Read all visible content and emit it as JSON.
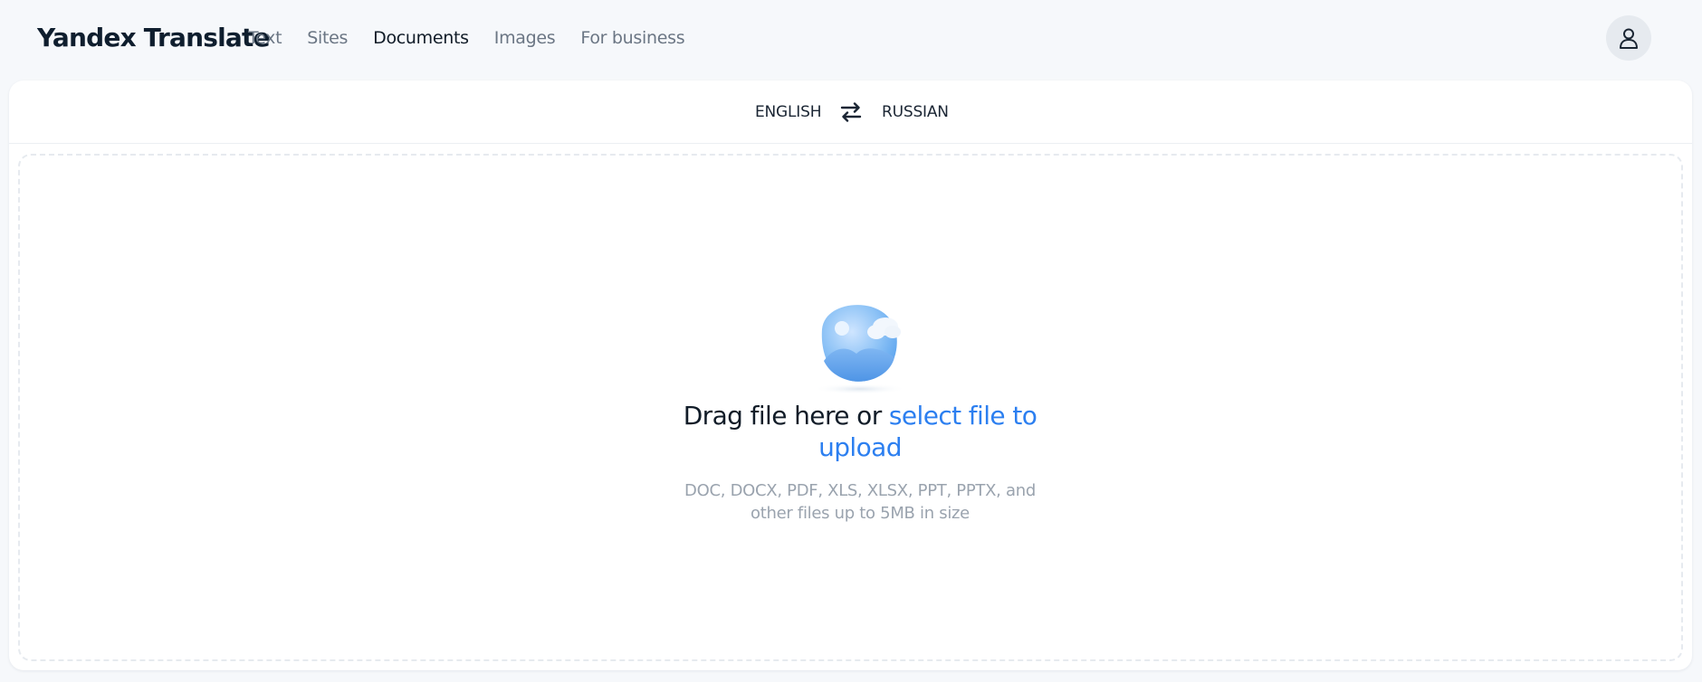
{
  "app": {
    "title": "Yandex Translate"
  },
  "nav": {
    "items": [
      {
        "label": "Text",
        "active": false
      },
      {
        "label": "Sites",
        "active": false
      },
      {
        "label": "Documents",
        "active": true
      },
      {
        "label": "Images",
        "active": false
      },
      {
        "label": "For business",
        "active": false
      }
    ]
  },
  "header": {
    "avatar_icon": "user-icon"
  },
  "languages": {
    "source": "ENGLISH",
    "target": "RUSSIAN",
    "swap_icon": "swap-arrows-icon"
  },
  "dropzone": {
    "title_prefix": "Drag file here or ",
    "title_link": "select file to upload",
    "hint": "DOC, DOCX, PDF, XLS, XLSX, PPT, PPTX, and other files up to 5MB in size",
    "illustration_icon": "image-upload-icon"
  },
  "colors": {
    "accent": "#2c7ff0",
    "page_background": "#f6f8fb",
    "text_primary": "#111c28",
    "text_muted": "#9aa3ae"
  }
}
